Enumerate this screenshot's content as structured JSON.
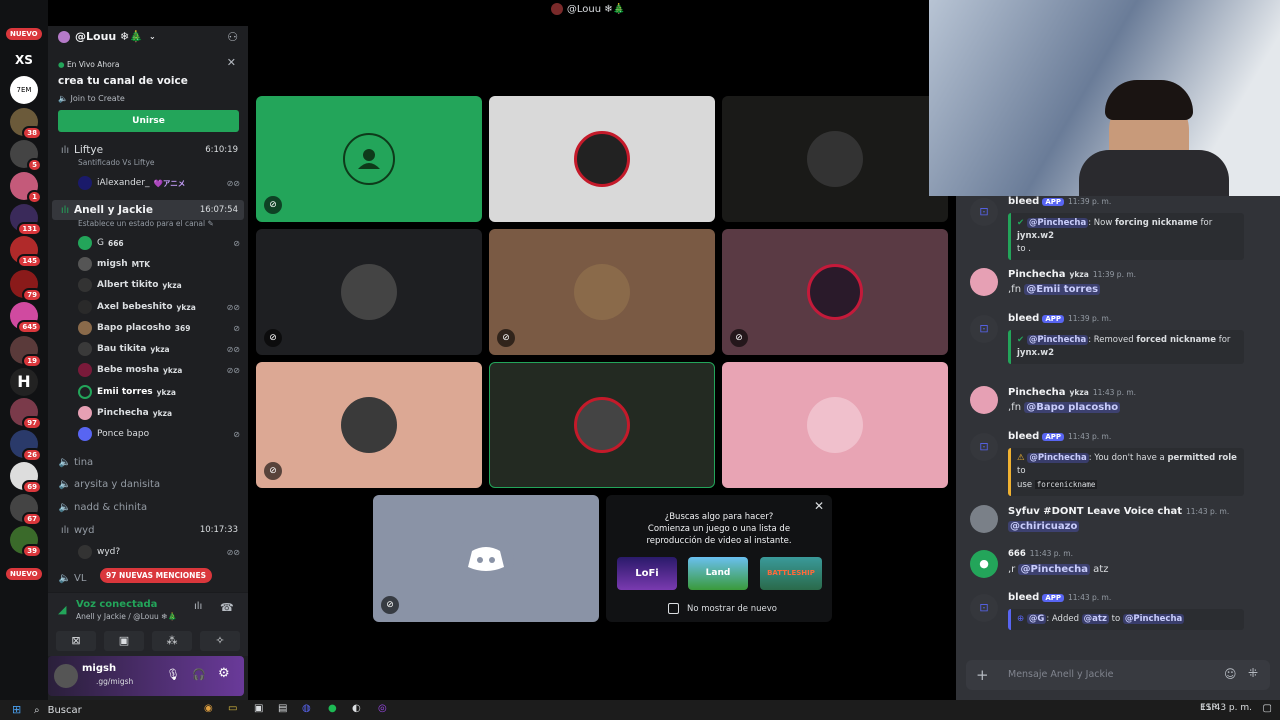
{
  "window": {
    "title": "@Louu ❄🎄"
  },
  "rail": {
    "badges": [
      "38",
      "5",
      "1",
      "131",
      "145",
      "79",
      "645",
      "19",
      "97",
      "26",
      "69",
      "67",
      "39"
    ],
    "nuevo_label": "NUEVO",
    "xs_label": "XS",
    "tem_label": "7EM"
  },
  "sidebar": {
    "server_name": "@Louu ❄🎄",
    "live": {
      "label": "En Vivo Ahora",
      "title": "crea tu canal de voice",
      "subtitle": "Join to Create",
      "join_button": "Unirse"
    },
    "channels": [
      {
        "name": "Liftye",
        "status": "Santificado Vs Liftye",
        "time": "6:10:19"
      },
      {
        "name": "Anell y Jackie",
        "status": "Establece un estado para el canal",
        "time": "16:07:54"
      }
    ],
    "liftye_user": {
      "name": "iAlexander_",
      "tag": "💜アニメ"
    },
    "anell_users": [
      {
        "name": "G",
        "tag": "666"
      },
      {
        "name": "migsh",
        "tag": "MTK"
      },
      {
        "name": "Albert tikito",
        "tag": "ykza"
      },
      {
        "name": "Axel bebeshito",
        "tag": "ykza"
      },
      {
        "name": "Bapo placosho",
        "tag": "369"
      },
      {
        "name": "Bau tikita",
        "tag": "ykza"
      },
      {
        "name": "Bebe mosha",
        "tag": "ykza"
      },
      {
        "name": "Emii torres",
        "tag": "ykza"
      },
      {
        "name": "Pinchecha",
        "tag": "ykza"
      },
      {
        "name": "Ponce bapo",
        "tag": ""
      }
    ],
    "other_channels": [
      "tina",
      "arysita y danisita",
      "nadd & chinita"
    ],
    "wyd": {
      "name": "wyd",
      "time": "10:17:33",
      "user": "wyd?"
    },
    "vl": {
      "name": "VL",
      "mentions": "97 NUEVAS MENCIONES"
    },
    "voice": {
      "status": "Voz conectada",
      "channel": "Anell y Jackie / @Louu ❄🎄"
    },
    "user": {
      "name": "migsh",
      "sub": ".gg/migsh"
    }
  },
  "main": {
    "promo": {
      "line1": "¿Buscas algo para hacer?",
      "line2": "Comienza un juego o una lista de",
      "line3": "reproducción de video al instante.",
      "games": [
        "LoFi",
        "Land",
        "BATTLESHIP"
      ],
      "checkbox": "No mostrar de nuevo"
    }
  },
  "chat": {
    "messages": [
      {
        "author": "bleed",
        "app": "APP",
        "time": "11:39 p. m.",
        "embed1": "@Pinchecha",
        "embed2": ": Now ",
        "embed3": "forcing nickname",
        "embed4": " for ",
        "embed5": "jynx.w2",
        "embed6": "to ."
      },
      {
        "author": "Pinchecha",
        "tag": "ykza",
        "time": "11:39 p. m.",
        "body": ",fn ",
        "mention": "@Emii torres"
      },
      {
        "author": "bleed",
        "app": "APP",
        "time": "11:39 p. m.",
        "embed1": "@Pinchecha",
        "embed2": ": Removed ",
        "embed3": "forced nickname",
        "embed4": " for",
        "embed5": "jynx.w2"
      },
      {
        "author": "Pinchecha",
        "tag": "ykza",
        "time": "11:43 p. m.",
        "body": ",fn ",
        "mention": "@Bapo placosho"
      },
      {
        "author": "bleed",
        "app": "APP",
        "time": "11:43 p. m.",
        "embed1": "@Pinchecha",
        "embed2": ": You don't have a ",
        "embed3": "permitted role",
        "embed4": " to",
        "embed5": "use ",
        "code": "forcenickname"
      },
      {
        "author": "Syfuv #DONT Leave Voice chat",
        "time": "11:43 p. m.",
        "mention": "@chiricuazo"
      },
      {
        "author": "666",
        "time": "11:43 p. m.",
        "body": ",r ",
        "mention": "@Pinchecha",
        "tail": " atz"
      },
      {
        "author": "bleed",
        "app": "APP",
        "time": "11:43 p. m.",
        "embed1": "@G",
        "embed2": ": Added ",
        "embed3": "@atz",
        "embed4": " to ",
        "embed5": "@Pinchecha"
      }
    ],
    "input_placeholder": "Mensaje Anell y Jackie"
  },
  "taskbar": {
    "search": "Buscar",
    "lang": "ESP",
    "clock": "11:43 p. m."
  },
  "colors": {
    "green": "#23a55a",
    "blurple": "#5865f2",
    "red": "#da373c"
  }
}
